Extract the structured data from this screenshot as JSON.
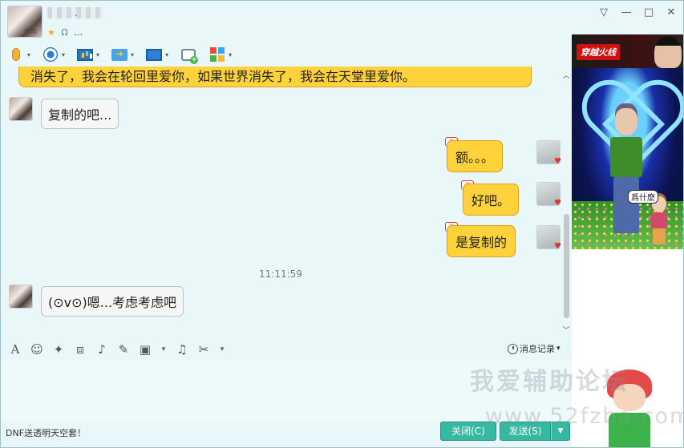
{
  "window": {
    "avatar_nick": "斈咔",
    "title_dot": "·",
    "status_icons": [
      "★",
      "Ω",
      "…"
    ],
    "controls": {
      "menu": "▽",
      "minimize": "—",
      "maximize": "□",
      "close": "✕"
    }
  },
  "toolbar": {
    "items": [
      {
        "icon": "microphone-icon"
      },
      {
        "icon": "webcam-icon"
      },
      {
        "icon": "screen-share-icon"
      },
      {
        "icon": "file-transfer-icon"
      },
      {
        "icon": "remote-desktop-icon"
      },
      {
        "icon": "add-chat-icon"
      },
      {
        "icon": "apps-icon"
      }
    ],
    "dropdown_glyph": "▾"
  },
  "chat": {
    "top_message": "消失了，我会在轮回里爱你，如果世界消失了，我会在天堂里爱你。",
    "messages": [
      {
        "side": "left",
        "text": "复制的吧..."
      },
      {
        "side": "right",
        "text": "额。。。"
      },
      {
        "side": "right",
        "text": "好吧。"
      },
      {
        "side": "right",
        "text": "是复制的"
      },
      {
        "side": "left",
        "text": "(⊙v⊙)嗯...考虑考虑吧"
      }
    ],
    "badge_text": "㊣",
    "timestamp": "11:11:59",
    "scroll_up": "︿",
    "scroll_down": "﹀"
  },
  "format_toolbar": {
    "font": "A",
    "emoji": "☺",
    "magic": "✦",
    "screenshot": "⧈",
    "voice": "♪",
    "edit": "✎",
    "image": "▣",
    "music": "♫",
    "cut": "✂",
    "dropdown": "▾",
    "history_label": "消息记录"
  },
  "footer": {
    "status_text": "DNF送透明天空套！",
    "close_button": "关闭(C)",
    "send_button": "发送(S)",
    "send_dropdown": "▼"
  },
  "right_panel": {
    "ad_logo": "穿越火线",
    "show_caption": "爲什麽"
  },
  "watermark": {
    "text": "我爱辅助论坛",
    "url": "www.52fzba.com"
  },
  "colors": {
    "accent": "#37b8a3",
    "bubble_self": "#ffd23c",
    "bubble_other": "#f5f7f7",
    "background": "#eaf7f8"
  }
}
